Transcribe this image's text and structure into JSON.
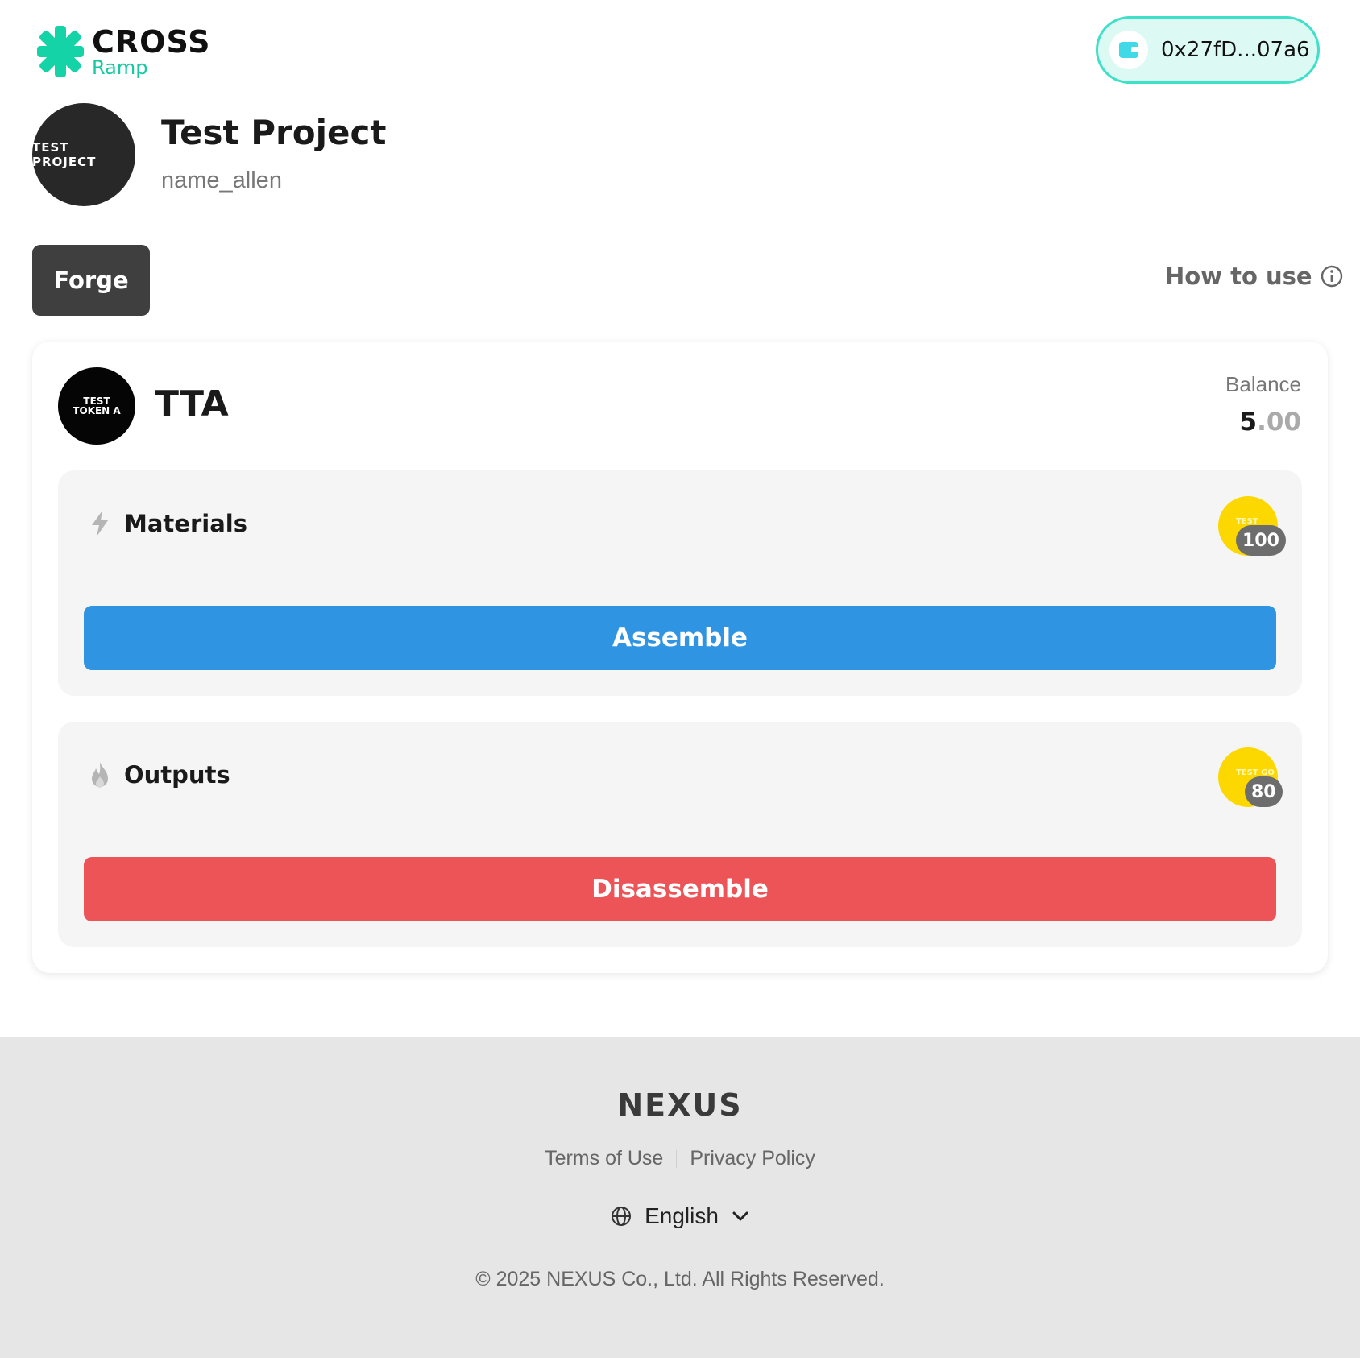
{
  "header": {
    "logo_title": "CROSS",
    "logo_subtitle": "Ramp",
    "wallet_address": "0x27fD...07a6",
    "wallet_icon": "wallet-icon"
  },
  "project": {
    "avatar_text": "TEST PROJECT",
    "title": "Test Project",
    "username": "name_allen"
  },
  "toolbar": {
    "forge_label": "Forge",
    "how_to_use_label": "How to use",
    "info_icon": "info-icon"
  },
  "token": {
    "avatar_line1": "TEST",
    "avatar_line2": "TOKEN A",
    "name": "TTA",
    "balance_label": "Balance",
    "balance_int": "5",
    "balance_dec": ".00"
  },
  "materials": {
    "title": "Materials",
    "icon": "lightning-icon",
    "coin_text": "TEST",
    "quantity": "100",
    "button_label": "Assemble"
  },
  "outputs": {
    "title": "Outputs",
    "icon": "flame-icon",
    "coin_text": "TEST GO",
    "quantity": "80",
    "button_label": "Disassemble"
  },
  "footer": {
    "brand": "NEXUS",
    "terms_label": "Terms of Use",
    "privacy_label": "Privacy Policy",
    "language": "English",
    "copyright": "© 2025 NEXUS Co., Ltd. All Rights Reserved."
  },
  "colors": {
    "accent_teal": "#3fe0c8",
    "assemble_blue": "#2f95e2",
    "disassemble_red": "#ec5457",
    "coin_yellow": "#fcd800"
  }
}
